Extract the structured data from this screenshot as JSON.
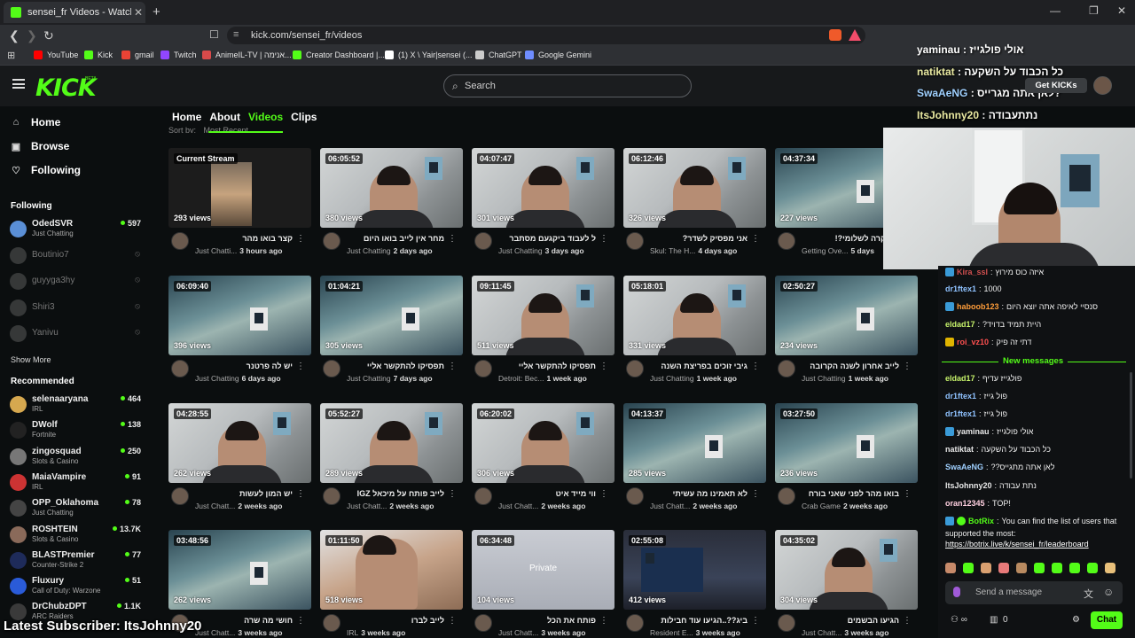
{
  "browser": {
    "tab_title": "sensei_fr Videos - Watch On-De",
    "url": "kick.com/sensei_fr/videos",
    "bookmarks": [
      {
        "label": "YouTube",
        "color": "#ff0000"
      },
      {
        "label": "Kick",
        "color": "#53fc18"
      },
      {
        "label": "gmail",
        "color": "#ea4335"
      },
      {
        "label": "Twitch",
        "color": "#9146ff"
      },
      {
        "label": "AnimeIL-TV | אנימה...",
        "color": "#d94a4a"
      },
      {
        "label": "Creator Dashboard |...",
        "color": "#53fc18"
      },
      {
        "label": "(1) X \\ Yair|sensei (...",
        "color": "#ffffff"
      },
      {
        "label": "ChatGPT",
        "color": "#cccccc"
      },
      {
        "label": "Google Gemini",
        "color": "#6f8dff"
      }
    ]
  },
  "header": {
    "search_placeholder": "Search"
  },
  "sidebar": {
    "nav": [
      "Home",
      "Browse",
      "Following"
    ],
    "following_heading": "Following",
    "following": [
      {
        "name": "OdedSVR",
        "cat": "Just Chatting",
        "viewers": "597",
        "online": true,
        "color": "#5a8fd6"
      },
      {
        "name": "Boutinio7",
        "online": false,
        "color": "#888"
      },
      {
        "name": "guyyga3hy",
        "online": false,
        "color": "#888"
      },
      {
        "name": "Shiri3",
        "online": false,
        "color": "#888"
      },
      {
        "name": "Yanivu",
        "online": false,
        "color": "#888"
      }
    ],
    "show_more": "Show More",
    "recommended_heading": "Recommended",
    "recommended": [
      {
        "name": "selenaaryana",
        "cat": "IRL",
        "viewers": "464",
        "color": "#d6a84f"
      },
      {
        "name": "DWolf",
        "cat": "Fortnite",
        "viewers": "138",
        "color": "#222"
      },
      {
        "name": "zingosquad",
        "cat": "Slots & Casino",
        "viewers": "250",
        "color": "#777"
      },
      {
        "name": "MaiaVampire",
        "cat": "IRL",
        "viewers": "91",
        "color": "#c33"
      },
      {
        "name": "OPP_Oklahoma",
        "cat": "Just Chatting",
        "viewers": "78",
        "color": "#444"
      },
      {
        "name": "ROSHTEIN",
        "cat": "Slots & Casino",
        "viewers": "13.7K",
        "color": "#8a6a5a"
      },
      {
        "name": "BLASTPremier",
        "cat": "Counter-Strike 2",
        "viewers": "77",
        "color": "#1e2b5a"
      },
      {
        "name": "Fluxury",
        "cat": "Call of Duty: Warzone",
        "viewers": "51",
        "color": "#2a5bd8"
      },
      {
        "name": "DrChubzDPT",
        "cat": "ARC Raiders",
        "viewers": "1.1K",
        "color": "#3a3a3a"
      }
    ]
  },
  "channel_tabs": [
    "Home",
    "About",
    "Videos",
    "Clips"
  ],
  "sort": {
    "label": "Sort by:",
    "value": "Most Recent"
  },
  "videos": [
    {
      "dur": "Current Stream",
      "views": "293 views",
      "title": "קצר בואו מהר",
      "cat": "Just Chatti...",
      "ago": "3 hours ago",
      "thumb": "stream"
    },
    {
      "dur": "06:05:52",
      "views": "380 views",
      "title": "מחר אין לייב בואו היום",
      "cat": "Just Chatting",
      "ago": "2 days ago",
      "thumb": "room"
    },
    {
      "dur": "04:07:47",
      "views": "301 views",
      "title": "ל לעבוד ביקגעם מסתבר",
      "cat": "Just Chatting",
      "ago": "3 days ago",
      "thumb": "room"
    },
    {
      "dur": "06:12:46",
      "views": "326 views",
      "title": "אני מפסיק לשדר?",
      "cat": "Skul: The H...",
      "ago": "4 days ago",
      "thumb": "room"
    },
    {
      "dur": "04:37:34",
      "views": "227 views",
      "title": "מה קרה לשלומי?!",
      "cat": "Getting Ove...",
      "ago": "5 days",
      "thumb": "game"
    },
    {
      "dur": "06:09:40",
      "views": "396 views",
      "title": "יש לה פרטנר",
      "cat": "Just Chatting",
      "ago": "6 days ago",
      "thumb": "game"
    },
    {
      "dur": "01:04:21",
      "views": "305 views",
      "title": "תפסיקו להתקשר אליי",
      "cat": "Just Chatting",
      "ago": "7 days ago",
      "thumb": "game"
    },
    {
      "dur": "09:11:45",
      "views": "511 views",
      "title": "תפסיקו להתקשר אליי",
      "cat": "Detroit: Bec...",
      "ago": "1 week ago",
      "thumb": "room"
    },
    {
      "dur": "05:18:01",
      "views": "331 views",
      "title": "גיבי זוכים בפריצת השנה",
      "cat": "Just Chatting",
      "ago": "1 week ago",
      "thumb": "room"
    },
    {
      "dur": "02:50:27",
      "views": "234 views",
      "title": "לייב אחרון לשנה הקרובה",
      "cat": "Just Chatting",
      "ago": "1 week ago",
      "thumb": "game"
    },
    {
      "dur": "04:28:55",
      "views": "262 views",
      "title": "יש המון לעשות",
      "cat": "Just Chatt...",
      "ago": "2 weeks ago",
      "thumb": "room"
    },
    {
      "dur": "05:52:27",
      "views": "289 views",
      "title": "לייב פותח על מיכאל IGZ",
      "cat": "Just Chatt...",
      "ago": "2 weeks ago",
      "thumb": "room"
    },
    {
      "dur": "06:20:02",
      "views": "306 views",
      "title": "ווי מייד איט",
      "cat": "Just Chatt...",
      "ago": "2 weeks ago",
      "thumb": "room"
    },
    {
      "dur": "04:13:37",
      "views": "285 views",
      "title": "לא תאמינו מה עשיתי",
      "cat": "Just Chatt...",
      "ago": "2 weeks ago",
      "thumb": "game"
    },
    {
      "dur": "03:27:50",
      "views": "236 views",
      "title": "בואו מהר לפני שאני בורח",
      "cat": "Crab Game",
      "ago": "2 weeks ago",
      "thumb": "game"
    },
    {
      "dur": "03:48:56",
      "views": "262 views",
      "title": "חושי מה שרה",
      "cat": "Just Chatt...",
      "ago": "3 weeks ago",
      "thumb": "game"
    },
    {
      "dur": "01:11:50",
      "views": "518 views",
      "title": "לייב לברו",
      "cat": "IRL",
      "ago": "3 weeks ago",
      "thumb": "face"
    },
    {
      "dur": "06:34:48",
      "views": "104 views",
      "title": "פותח את הכל",
      "cat": "Just Chatt...",
      "ago": "3 weeks ago",
      "thumb": "blur",
      "private": "Private"
    },
    {
      "dur": "02:55:08",
      "views": "412 views",
      "title": "ביג??..הגיעו עוד חבילות",
      "cat": "Resident E...",
      "ago": "3 weeks ago",
      "thumb": "desk"
    },
    {
      "dur": "04:35:02",
      "views": "304 views",
      "title": "הגיעו הבשמים",
      "cat": "Just Chatt...",
      "ago": "3 weeks ago",
      "thumb": "room"
    }
  ],
  "overlay": {
    "top_lines": [
      {
        "user": "yaminau",
        "msg": "אולי פולגייז"
      },
      {
        "user": "natiktat",
        "msg": "כל הכבוד על השקעה"
      },
      {
        "user": "SwaAeNG",
        "msg": "לאן אתה מגרייס?"
      },
      {
        "user": "ItsJohnny20",
        "msg": "נתתעבודה"
      }
    ],
    "get_kicks": "Get KICKs",
    "latest": "Latest Subscriber: ItsJohnny20"
  },
  "chat": {
    "lines": [
      {
        "user": "Kira_ssl",
        "msg": "איזה כוס מירוץ",
        "ucolor": "#d04f4f",
        "badge": "#3a9bd8"
      },
      {
        "user": "dr1ftex1",
        "msg": "1000",
        "ucolor": "#8fc2ff",
        "badge": ""
      },
      {
        "user": "haboob123",
        "msg": "סנסיי לאיפה אתה יוצא היום",
        "ucolor": "#ff9d3a",
        "badge": "#3a9bd8"
      },
      {
        "user": "eldad17",
        "msg": "היית תמיד בדויד?",
        "ucolor": "#c7f36b",
        "badge": ""
      },
      {
        "user": "roi_vz10",
        "msg": "דתי זה פיק",
        "ucolor": "#ff5050",
        "badge": "#e0b400"
      },
      {
        "user": "eldad17",
        "msg": "פולגייז עדיף",
        "ucolor": "#c7f36b",
        "badge": ""
      },
      {
        "user": "dr1ftex1",
        "msg": "פול גייז",
        "ucolor": "#8fc2ff",
        "badge": ""
      },
      {
        "user": "dr1ftex1",
        "msg": "פול גייז",
        "ucolor": "#8fc2ff",
        "badge": ""
      },
      {
        "user": "yaminau",
        "msg": "אולי פולגייז",
        "ucolor": "#e8e8e8",
        "badge": "#3a9bd8"
      },
      {
        "user": "natiktat",
        "msg": "כל הכבוד על השקעה",
        "ucolor": "#e8e8e8",
        "badge": ""
      },
      {
        "user": "SwaAeNG",
        "msg": "לאן אתה מתגייס??",
        "ucolor": "#9fd0ff",
        "badge": ""
      },
      {
        "user": "ItsJohnny20",
        "msg": "נתת עבודה",
        "ucolor": "#e8e8e8",
        "badge": ""
      },
      {
        "user": "oran12345",
        "msg": "!TOP",
        "ucolor": "#ffd0e0",
        "badge": ""
      }
    ],
    "bot_user": "BotRix",
    "bot_msg1": "You can find the list of users that",
    "bot_msg2": "supported the most:",
    "bot_link": "https://botrix.live/k/sensei_fr/leaderboard",
    "new_messages": "New messages",
    "placeholder": "Send a message",
    "chat_button": "Chat",
    "bottom_count": "0"
  }
}
